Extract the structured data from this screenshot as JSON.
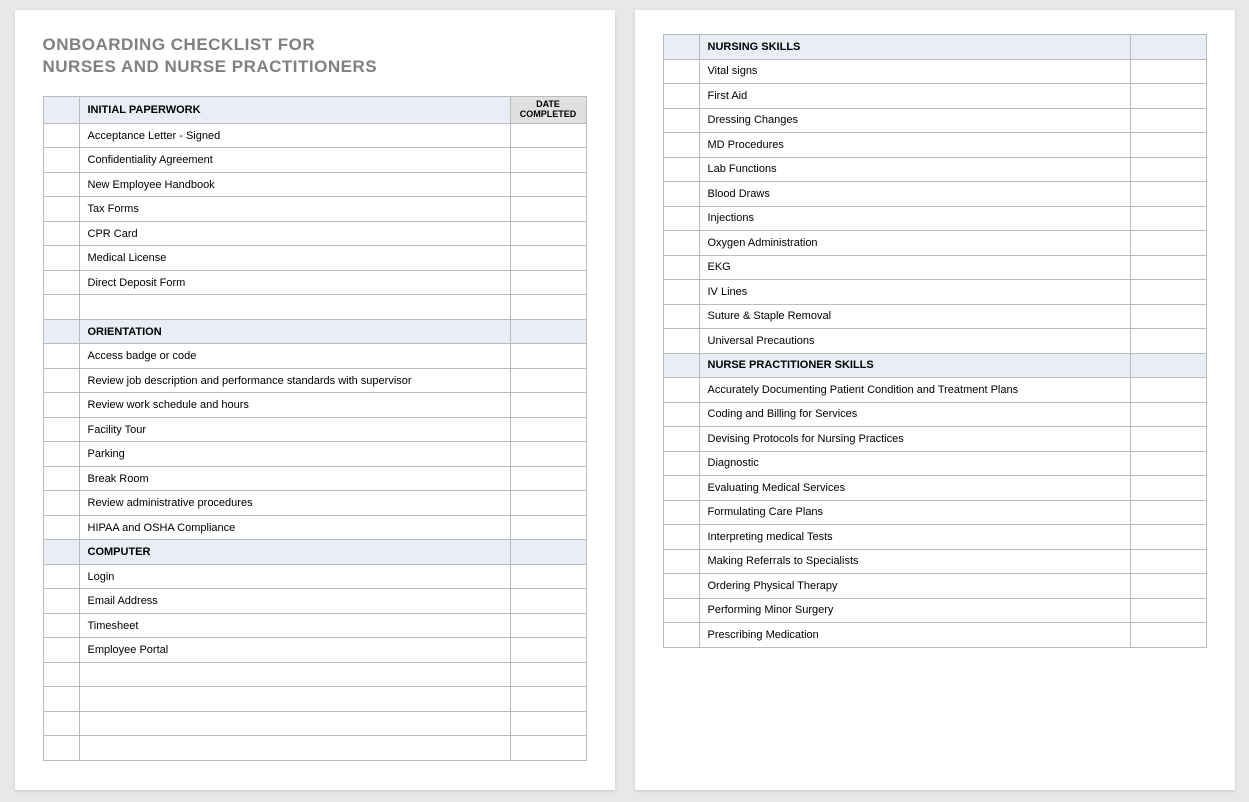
{
  "title_line1": "ONBOARDING CHECKLIST FOR",
  "title_line2": "NURSES AND NURSE PRACTITIONERS",
  "date_completed_header": "DATE COMPLETED",
  "sections": {
    "initial_paperwork": {
      "header": "INITIAL PAPERWORK",
      "items": [
        "Acceptance Letter - Signed",
        "Confidentiality Agreement",
        "New Employee Handbook",
        "Tax Forms",
        "CPR Card",
        "Medical License",
        "Direct Deposit Form"
      ]
    },
    "orientation": {
      "header": "ORIENTATION",
      "items": [
        "Access badge or code",
        "Review job description and performance standards with supervisor",
        "Review work schedule and hours",
        "Facility Tour",
        "Parking",
        "Break Room",
        "Review administrative procedures",
        "HIPAA and OSHA Compliance"
      ]
    },
    "computer": {
      "header": "COMPUTER",
      "items": [
        "Login",
        "Email Address",
        "Timesheet",
        "Employee Portal"
      ]
    },
    "nursing_skills": {
      "header": "NURSING SKILLS",
      "items": [
        "Vital signs",
        "First Aid",
        "Dressing Changes",
        "MD Procedures",
        "Lab Functions",
        "Blood Draws",
        "Injections",
        "Oxygen Administration",
        "EKG",
        "IV Lines",
        "Suture & Staple Removal",
        "Universal Precautions"
      ]
    },
    "np_skills": {
      "header": "NURSE PRACTITIONER SKILLS",
      "items": [
        "Accurately Documenting Patient Condition and Treatment Plans",
        "Coding and Billing for Services",
        "Devising Protocols for Nursing Practices",
        "Diagnostic",
        "Evaluating Medical Services",
        "Formulating Care Plans",
        "Interpreting medical Tests",
        "Making Referrals to Specialists",
        "Ordering Physical Therapy",
        "Performing Minor Surgery",
        "Prescribing Medication"
      ]
    }
  }
}
